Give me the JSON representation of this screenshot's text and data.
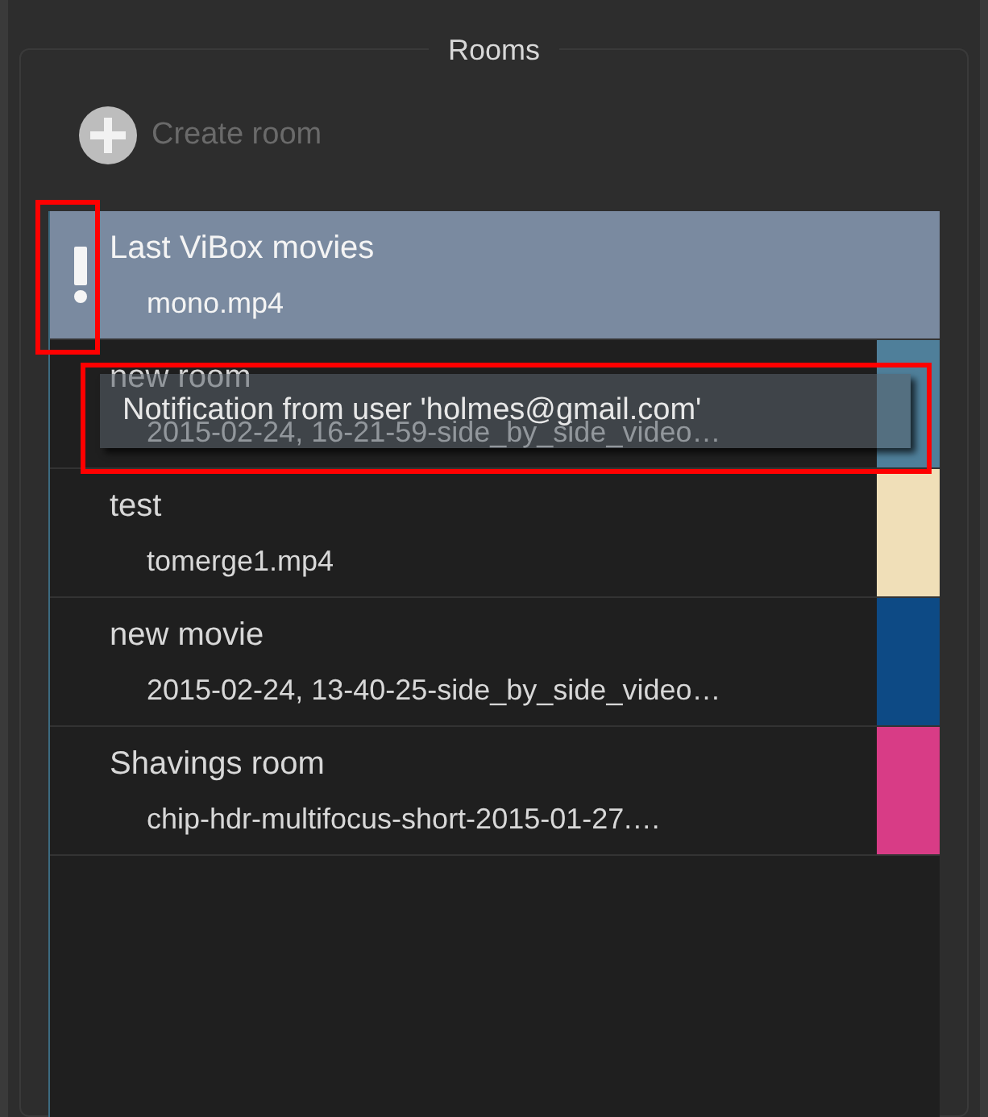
{
  "group_title": "Rooms",
  "create_button": {
    "label": "Create room",
    "disabled": true
  },
  "rooms": [
    {
      "name": "Last ViBox movies",
      "file": "mono.mp4",
      "selected": true,
      "notification": true
    },
    {
      "name": "new room",
      "file": "2015-02-24, 16-21-59-side_by_side_video…",
      "selected": false,
      "notification": false,
      "color": "#4f7f9a"
    },
    {
      "name": "test",
      "file": "tomerge1.mp4",
      "selected": false,
      "notification": false,
      "color": "#f0dfb8"
    },
    {
      "name": "new movie",
      "file": "2015-02-24, 13-40-25-side_by_side_video…",
      "selected": false,
      "notification": false,
      "color": "#0d4a85"
    },
    {
      "name": "Shavings room",
      "file": "chip-hdr-multifocus-short-2015-01-27.…",
      "selected": false,
      "notification": false,
      "color": "#d83c86"
    }
  ],
  "tooltip": {
    "text": "Notification from user 'holmes@gmail.com'"
  }
}
